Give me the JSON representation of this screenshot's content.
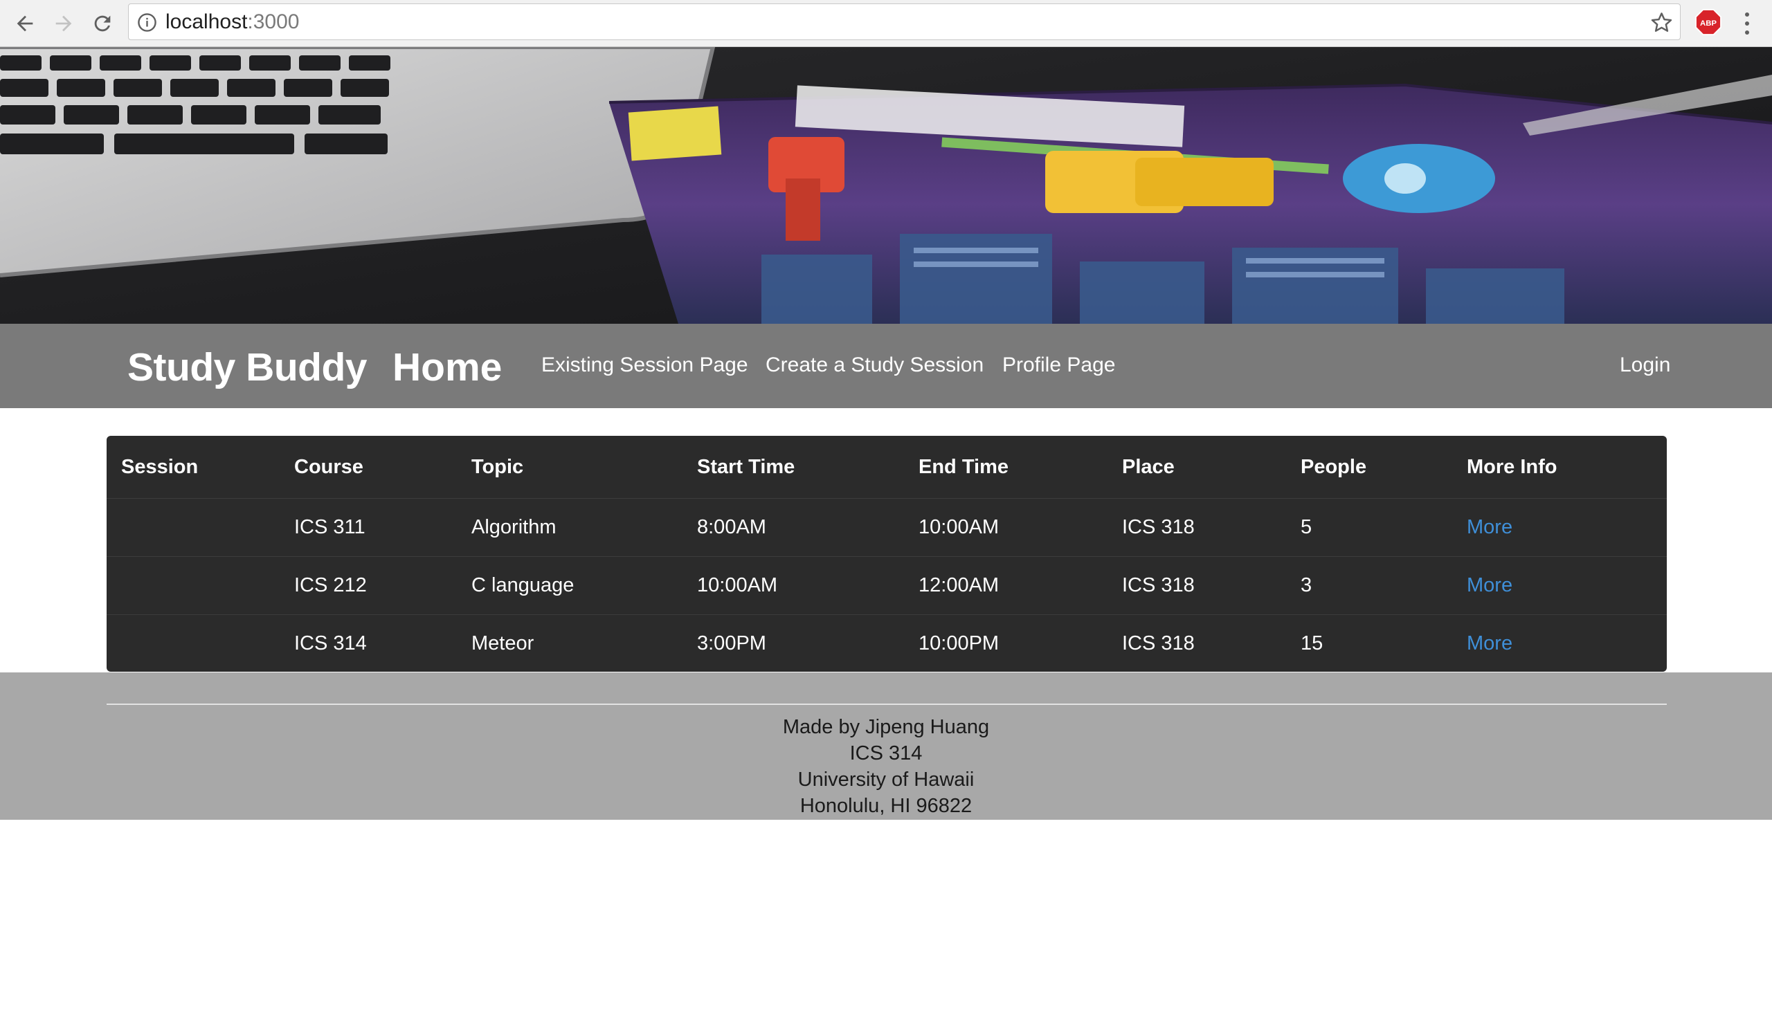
{
  "browser": {
    "url_host": "localhost",
    "url_port": ":3000",
    "icons": [
      "back-icon",
      "forward-icon",
      "reload-icon",
      "info-icon",
      "star-icon",
      "adblock-icon",
      "menu-icon"
    ],
    "adblock_label": "ABP"
  },
  "navbar": {
    "brand": "Study Buddy",
    "home": "Home",
    "links": [
      "Existing Session Page",
      "Create a Study Session",
      "Profile Page"
    ],
    "login": "Login",
    "background": "#7a7a7a"
  },
  "table": {
    "headers": [
      "Session",
      "Course",
      "Topic",
      "Start Time",
      "End Time",
      "Place",
      "People",
      "More Info"
    ],
    "rows": [
      {
        "session": "",
        "course": "ICS 311",
        "topic": "Algorithm",
        "start": "8:00AM",
        "end": "10:00AM",
        "place": "ICS 318",
        "people": "5",
        "more": "More"
      },
      {
        "session": "",
        "course": "ICS 212",
        "topic": "C language",
        "start": "10:00AM",
        "end": "12:00AM",
        "place": "ICS 318",
        "people": "3",
        "more": "More"
      },
      {
        "session": "",
        "course": "ICS 314",
        "topic": "Meteor",
        "start": "3:00PM",
        "end": "10:00PM",
        "place": "ICS 318",
        "people": "15",
        "more": "More"
      }
    ],
    "link_color": "#3f8fd8",
    "background": "#2b2b2b"
  },
  "footer": {
    "lines": [
      "Made by Jipeng Huang",
      "ICS 314",
      "University of Hawaii",
      "Honolulu, HI 96822"
    ],
    "background": "#a8a8a8"
  }
}
